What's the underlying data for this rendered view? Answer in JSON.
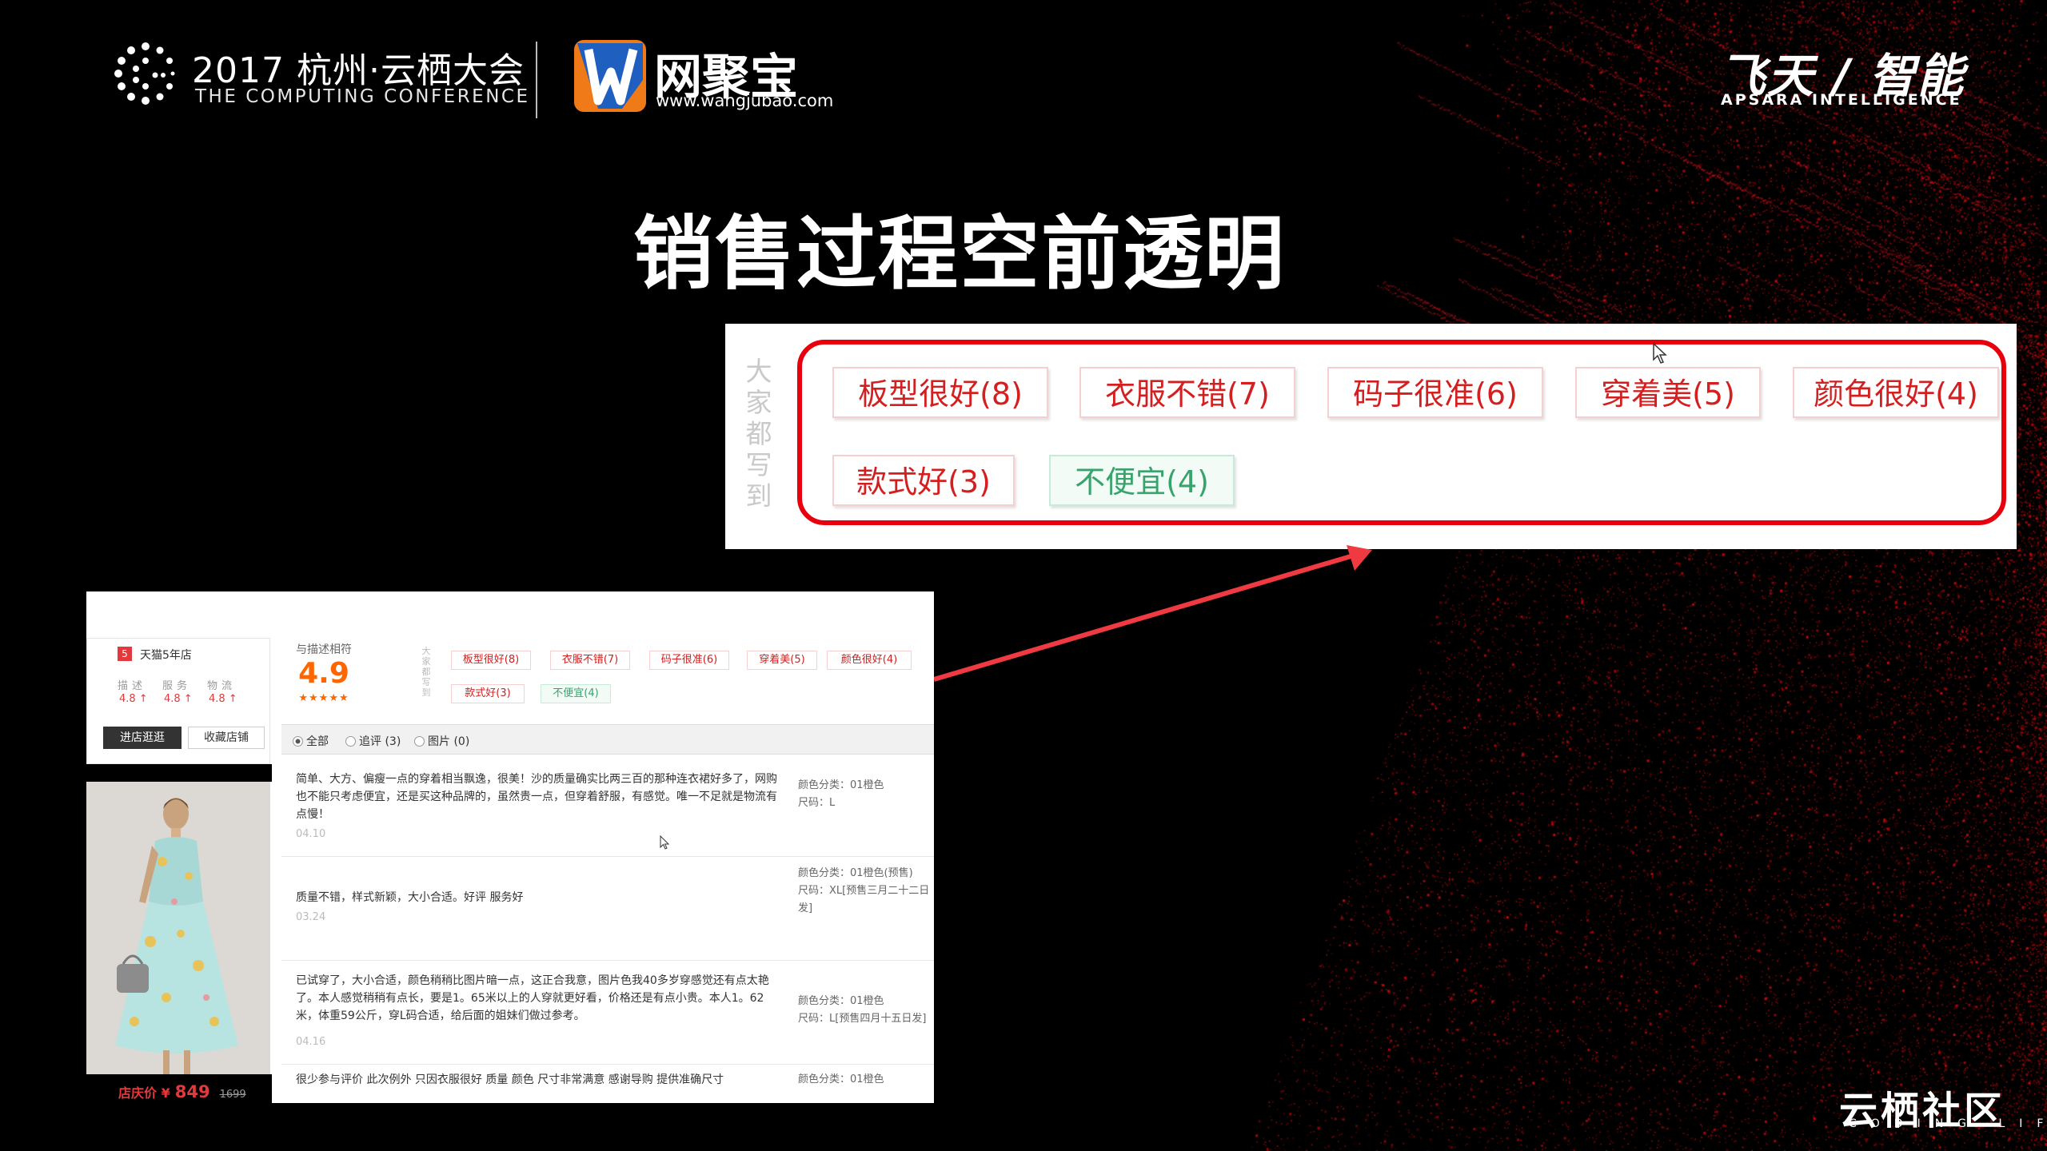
{
  "header": {
    "conference_title": "2017 杭州·云栖大会",
    "conference_subtitle": "THE COMPUTING CONFERENCE",
    "partner_name": "网聚宝",
    "partner_url": "www.wangjubao.com",
    "brand_cn": "飞天 / 智能",
    "brand_en": "APSARA INTELLIGENCE"
  },
  "slide_title": "销售过程空前透明",
  "zoom_panel": {
    "label": "大家都写到",
    "tags": [
      {
        "label": "板型很好(8)",
        "tone": "positive"
      },
      {
        "label": "衣服不错(7)",
        "tone": "positive"
      },
      {
        "label": "码子很准(6)",
        "tone": "positive"
      },
      {
        "label": "穿着美(5)",
        "tone": "positive"
      },
      {
        "label": "颜色很好(4)",
        "tone": "positive"
      },
      {
        "label": "款式好(3)",
        "tone": "positive"
      },
      {
        "label": "不便宜(4)",
        "tone": "negative"
      }
    ]
  },
  "shop": {
    "badge": "5",
    "years_label": "天猫5年店",
    "dsr_labels": [
      "描述",
      "服务",
      "物流"
    ],
    "dsr_scores": [
      "4.8 ↑",
      "4.8 ↑",
      "4.8 ↑"
    ],
    "enter_button": "进店逛逛",
    "favorite_button": "收藏店铺",
    "price_label": "店庆价 ¥",
    "price_value": "849",
    "original_price": "1699"
  },
  "rating": {
    "caption": "与描述相符",
    "score": "4.9",
    "stars": "★★★★★",
    "tag_label": "大家都写到",
    "tags": [
      {
        "label": "板型很好(8)",
        "tone": "positive"
      },
      {
        "label": "衣服不错(7)",
        "tone": "positive"
      },
      {
        "label": "码子很准(6)",
        "tone": "positive"
      },
      {
        "label": "穿着美(5)",
        "tone": "positive"
      },
      {
        "label": "颜色很好(4)",
        "tone": "positive"
      },
      {
        "label": "款式好(3)",
        "tone": "positive"
      },
      {
        "label": "不便宜(4)",
        "tone": "negative"
      }
    ]
  },
  "filters": {
    "all": "全部",
    "followup": "追评 (3)",
    "images": "图片 (0)",
    "checkbox_mark": "✔"
  },
  "reviews": [
    {
      "text": "简单、大方、偏瘦一点的穿着相当飘逸，很美！沙的质量确实比两三百的那种连衣裙好多了，网购也不能只考虑便宜，还是买这种品牌的，虽然贵一点，但穿着舒服，有感觉。唯一不足就是物流有点慢！",
      "date": "04.10",
      "meta_color": "颜色分类：01橙色",
      "meta_size": "尺码：L"
    },
    {
      "text": "质量不错，样式新颖，大小合适。好评 服务好",
      "date": "03.24",
      "meta_color": "颜色分类：01橙色(预售)",
      "meta_size": "尺码：XL[预售三月二十二日发]"
    },
    {
      "text": "已试穿了，大小合适，颜色稍稍比图片暗一点，这正合我意，图片色我40多岁穿感觉还有点太艳了。本人感觉稍稍有点长，要是1。65米以上的人穿就更好看，价格还是有点小贵。本人1。62米，体重59公斤，穿L码合适，给后面的姐妹们做过参考。",
      "date": "04.16",
      "meta_color": "颜色分类：01橙色",
      "meta_size": "尺码：L[预售四月十五日发]"
    },
    {
      "text": "很少参与评价 此次例外 只因衣服很好 质量 颜色 尺寸非常满意 感谢导购 提供准确尺寸",
      "date": "",
      "meta_color": "颜色分类：01橙色",
      "meta_size": ""
    }
  ],
  "footer": {
    "community_name": "云栖社区",
    "community_slogan": "CODING LIFE"
  },
  "colors": {
    "accent_red": "#e8000c",
    "tag_red": "#d31f1f",
    "tag_green": "#38a36c",
    "arrow": "#ef3a42",
    "price": "#e4393c",
    "partner_orange": "#f07a18",
    "partner_blue": "#1e5fbf"
  }
}
